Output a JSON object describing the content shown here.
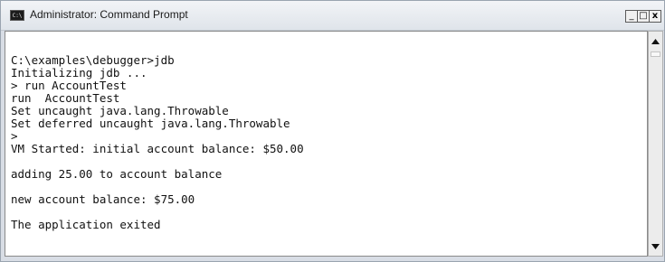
{
  "window": {
    "title": "Administrator: Command Prompt",
    "icon_text": "C:\\",
    "buttons": {
      "minimize": "_",
      "maximize": "□",
      "close": "x"
    }
  },
  "console": {
    "lines": [
      "",
      "C:\\examples\\debugger>jdb",
      "Initializing jdb ...",
      "> run AccountTest",
      "run  AccountTest",
      "Set uncaught java.lang.Throwable",
      "Set deferred uncaught java.lang.Throwable",
      ">",
      "VM Started: initial account balance: $50.00",
      "",
      "adding 25.00 to account balance",
      "",
      "new account balance: $75.00",
      "",
      "The application exited"
    ]
  },
  "scrollbar": {
    "up_icon": "scroll-up-arrow",
    "down_icon": "scroll-down-arrow"
  }
}
